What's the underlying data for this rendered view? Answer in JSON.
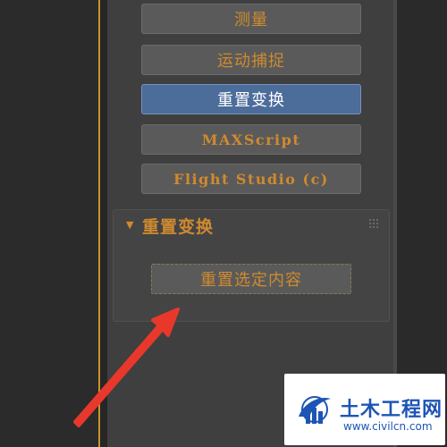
{
  "utilities": {
    "buttons": [
      {
        "label": "测量",
        "active": false
      },
      {
        "label": "运动捕捉",
        "active": false
      },
      {
        "label": "重置变换",
        "active": true
      },
      {
        "label": "MAXScript",
        "active": false
      },
      {
        "label": "Flight Studio (c)",
        "active": false
      }
    ]
  },
  "rollout": {
    "title": "重置变换",
    "expanded_icon": "triangle-down-icon",
    "action_label": "重置选定内容"
  },
  "annotation": {
    "pointer": "red-arrow-icon",
    "color": "#e8382c"
  },
  "watermark": {
    "name": "土木工程网",
    "url": "www.civilcn.com",
    "color": "#1d55b5"
  },
  "colors": {
    "accent_text": "#cf8a2f",
    "active_button": "#4c6c9a",
    "viewport_border": "#c9932a"
  }
}
